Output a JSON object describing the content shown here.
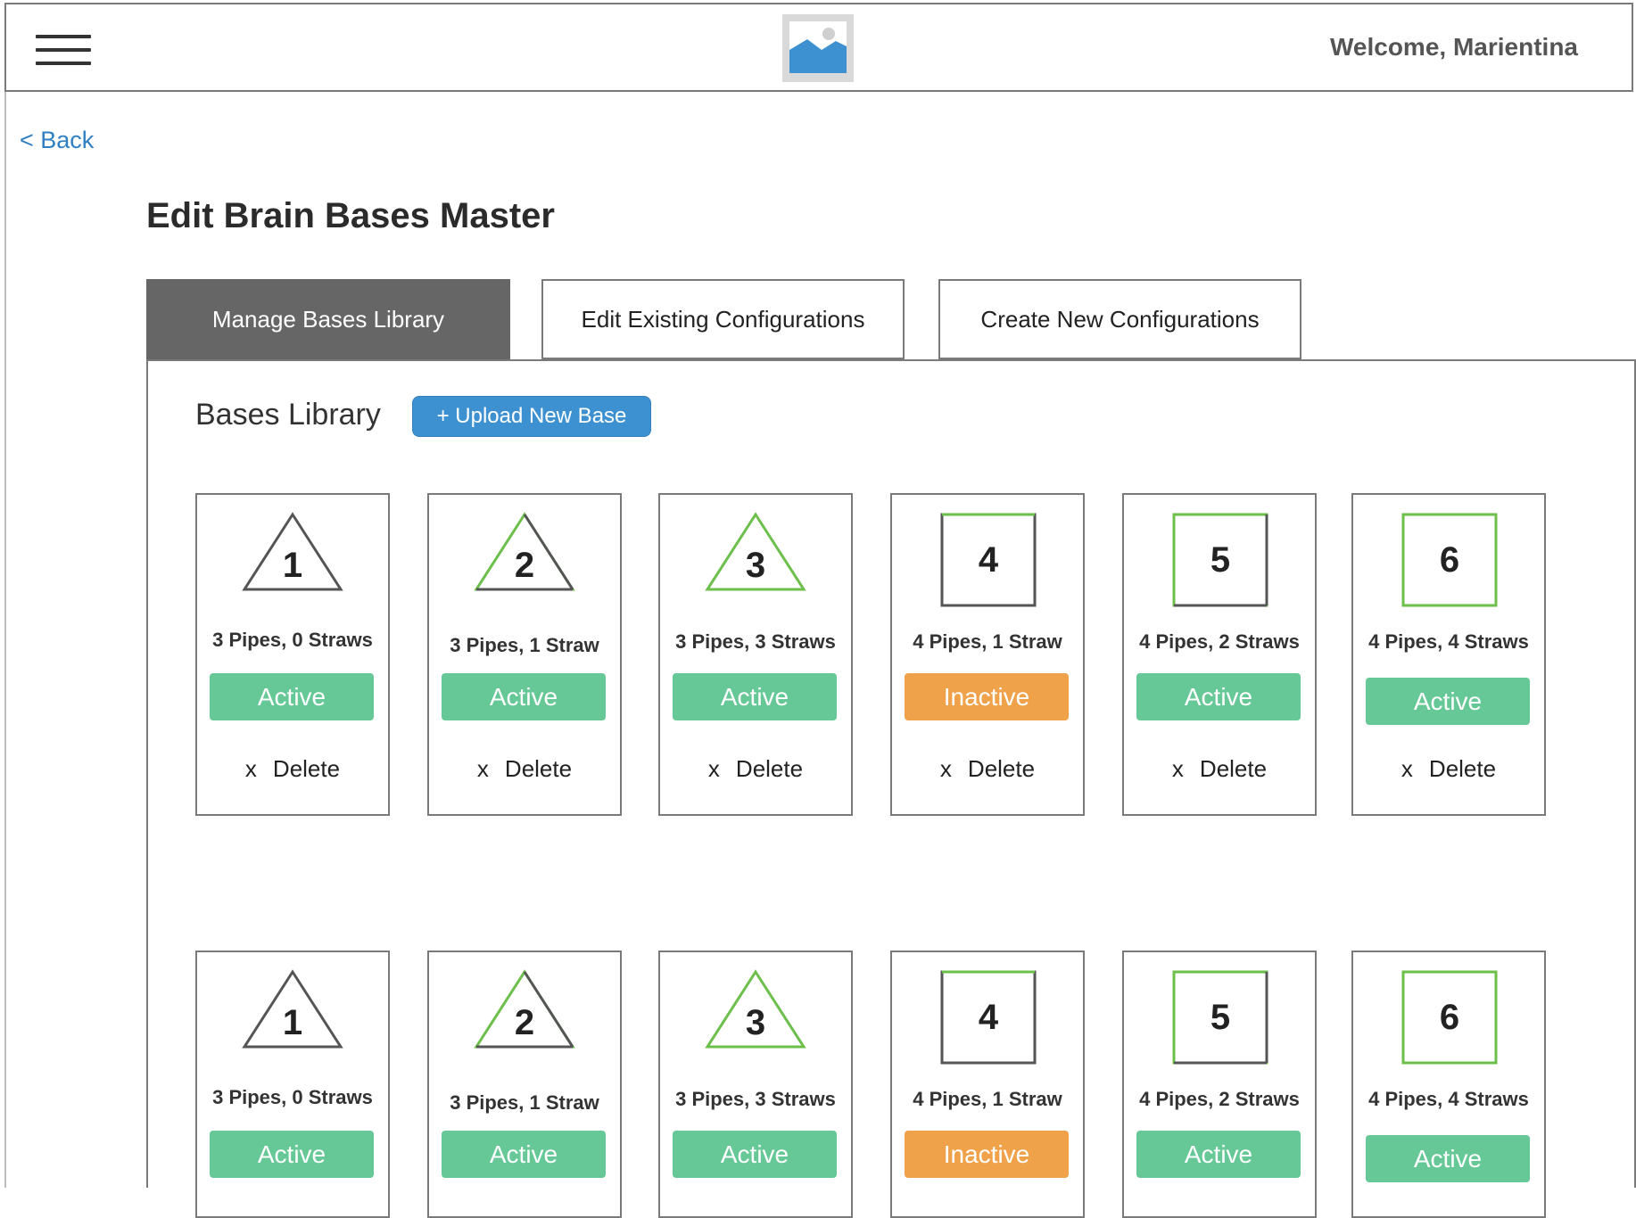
{
  "header": {
    "welcome_text": "Welcome, Marientina",
    "menu_icon": "hamburger-icon",
    "logo_icon": "image-placeholder-icon"
  },
  "back_link": "< Back",
  "page_title": "Edit Brain Bases Master",
  "tabs": [
    {
      "label": "Manage Bases Library",
      "active": true
    },
    {
      "label": "Edit Existing Configurations",
      "active": false
    },
    {
      "label": "Create New Configurations",
      "active": false
    }
  ],
  "library": {
    "title": "Bases Library",
    "upload_button": "+ Upload New Base"
  },
  "colors": {
    "active": "#66c896",
    "inactive": "#f0a24b",
    "accent": "#3d91d1",
    "tab_active": "#666666",
    "shape_green": "#6cbf4a"
  },
  "delete_label": "Delete",
  "delete_icon_text": "x",
  "bases_rows": [
    [
      {
        "number": "1",
        "shape": "triangle",
        "caption": "3 Pipes, 0 Straws",
        "status": "Active"
      },
      {
        "number": "2",
        "shape": "triangle",
        "caption": "3 Pipes, 1 Straw",
        "status": "Active"
      },
      {
        "number": "3",
        "shape": "triangle",
        "caption": "3 Pipes, 3 Straws",
        "status": "Active"
      },
      {
        "number": "4",
        "shape": "square",
        "caption": "4 Pipes, 1 Straw",
        "status": "Inactive"
      },
      {
        "number": "5",
        "shape": "square",
        "caption": "4 Pipes, 2 Straws",
        "status": "Active"
      },
      {
        "number": "6",
        "shape": "square",
        "caption": "4 Pipes, 4 Straws",
        "status": "Active"
      }
    ],
    [
      {
        "number": "1",
        "shape": "triangle",
        "caption": "3 Pipes, 0 Straws",
        "status": "Active"
      },
      {
        "number": "2",
        "shape": "triangle",
        "caption": "3 Pipes, 1 Straw",
        "status": "Active"
      },
      {
        "number": "3",
        "shape": "triangle",
        "caption": "3 Pipes, 3 Straws",
        "status": "Active"
      },
      {
        "number": "4",
        "shape": "square",
        "caption": "4 Pipes, 1 Straw",
        "status": "Inactive"
      },
      {
        "number": "5",
        "shape": "square",
        "caption": "4 Pipes, 2 Straws",
        "status": "Active"
      },
      {
        "number": "6",
        "shape": "square",
        "caption": "4 Pipes, 4 Straws",
        "status": "Active"
      }
    ]
  ]
}
